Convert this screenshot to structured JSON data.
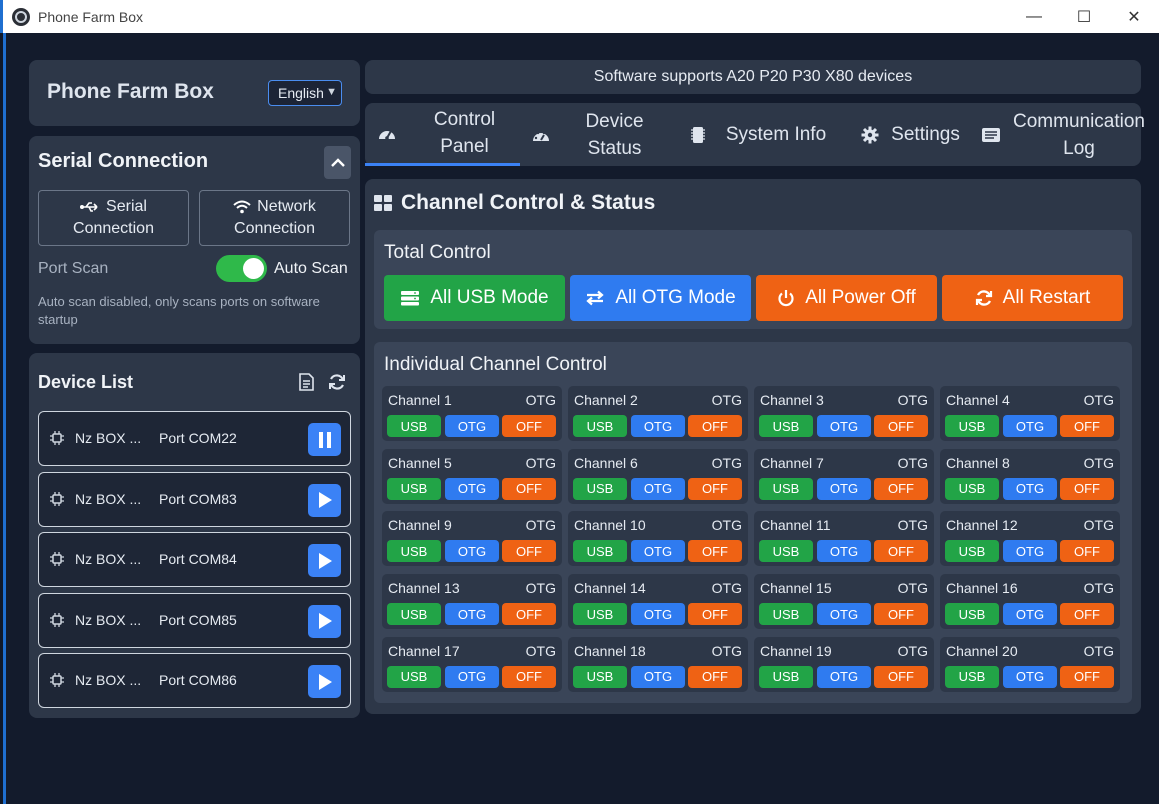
{
  "window": {
    "title": "Phone Farm Box",
    "minimize": "—",
    "maximize": "☐",
    "close": "✕"
  },
  "sidebar": {
    "brand": "Phone Farm Box",
    "language": "English",
    "serial": {
      "title": "Serial Connection",
      "serial_btn": [
        "Serial",
        "Connection"
      ],
      "network_btn": [
        "Network",
        "Connection"
      ],
      "port_scan": "Port Scan",
      "auto_scan": "Auto Scan",
      "auto_scan_on": true,
      "note": "Auto scan disabled, only scans ports on software startup"
    },
    "device_list": {
      "title": "Device List",
      "items": [
        {
          "name": "Nz BOX ...",
          "port": "Port COM22",
          "state": "pause"
        },
        {
          "name": "Nz BOX ...",
          "port": "Port COM83",
          "state": "play"
        },
        {
          "name": "Nz BOX ...",
          "port": "Port COM84",
          "state": "play"
        },
        {
          "name": "Nz BOX ...",
          "port": "Port COM85",
          "state": "play"
        },
        {
          "name": "Nz BOX ...",
          "port": "Port COM86",
          "state": "play"
        }
      ]
    }
  },
  "banner": "Software supports A20 P20 P30 X80 devices",
  "tabs": [
    {
      "label": [
        "Control",
        "Panel"
      ],
      "icon": "dashboard-icon",
      "active": true
    },
    {
      "label": [
        "Device",
        "Status"
      ],
      "icon": "gauge-icon",
      "active": false
    },
    {
      "label": [
        "System Info"
      ],
      "icon": "chip-icon",
      "active": false
    },
    {
      "label": [
        "Settings"
      ],
      "icon": "gear-icon",
      "active": false
    },
    {
      "label": [
        "Communication",
        "Log"
      ],
      "icon": "log-icon",
      "active": false
    }
  ],
  "main": {
    "title": "Channel Control & Status",
    "total_control": {
      "title": "Total Control",
      "buttons": [
        {
          "label": "All USB Mode",
          "color": "#22a447",
          "icon": "server-icon"
        },
        {
          "label": "All OTG Mode",
          "color": "#2f7bf0",
          "icon": "swap-icon"
        },
        {
          "label": "All Power Off",
          "color": "#ef6214",
          "icon": "power-icon"
        },
        {
          "label": "All Restart",
          "color": "#ef6214",
          "icon": "restart-icon"
        }
      ]
    },
    "individual": {
      "title": "Individual Channel Control",
      "button_labels": {
        "usb": "USB",
        "otg": "OTG",
        "off": "OFF"
      },
      "channels": [
        {
          "name": "Channel 1",
          "mode": "OTG"
        },
        {
          "name": "Channel 2",
          "mode": "OTG"
        },
        {
          "name": "Channel 3",
          "mode": "OTG"
        },
        {
          "name": "Channel 4",
          "mode": "OTG"
        },
        {
          "name": "Channel 5",
          "mode": "OTG"
        },
        {
          "name": "Channel 6",
          "mode": "OTG"
        },
        {
          "name": "Channel 7",
          "mode": "OTG"
        },
        {
          "name": "Channel 8",
          "mode": "OTG"
        },
        {
          "name": "Channel 9",
          "mode": "OTG"
        },
        {
          "name": "Channel 10",
          "mode": "OTG"
        },
        {
          "name": "Channel 11",
          "mode": "OTG"
        },
        {
          "name": "Channel 12",
          "mode": "OTG"
        },
        {
          "name": "Channel 13",
          "mode": "OTG"
        },
        {
          "name": "Channel 14",
          "mode": "OTG"
        },
        {
          "name": "Channel 15",
          "mode": "OTG"
        },
        {
          "name": "Channel 16",
          "mode": "OTG"
        },
        {
          "name": "Channel 17",
          "mode": "OTG"
        },
        {
          "name": "Channel 18",
          "mode": "OTG"
        },
        {
          "name": "Channel 19",
          "mode": "OTG"
        },
        {
          "name": "Channel 20",
          "mode": "OTG"
        }
      ]
    }
  }
}
